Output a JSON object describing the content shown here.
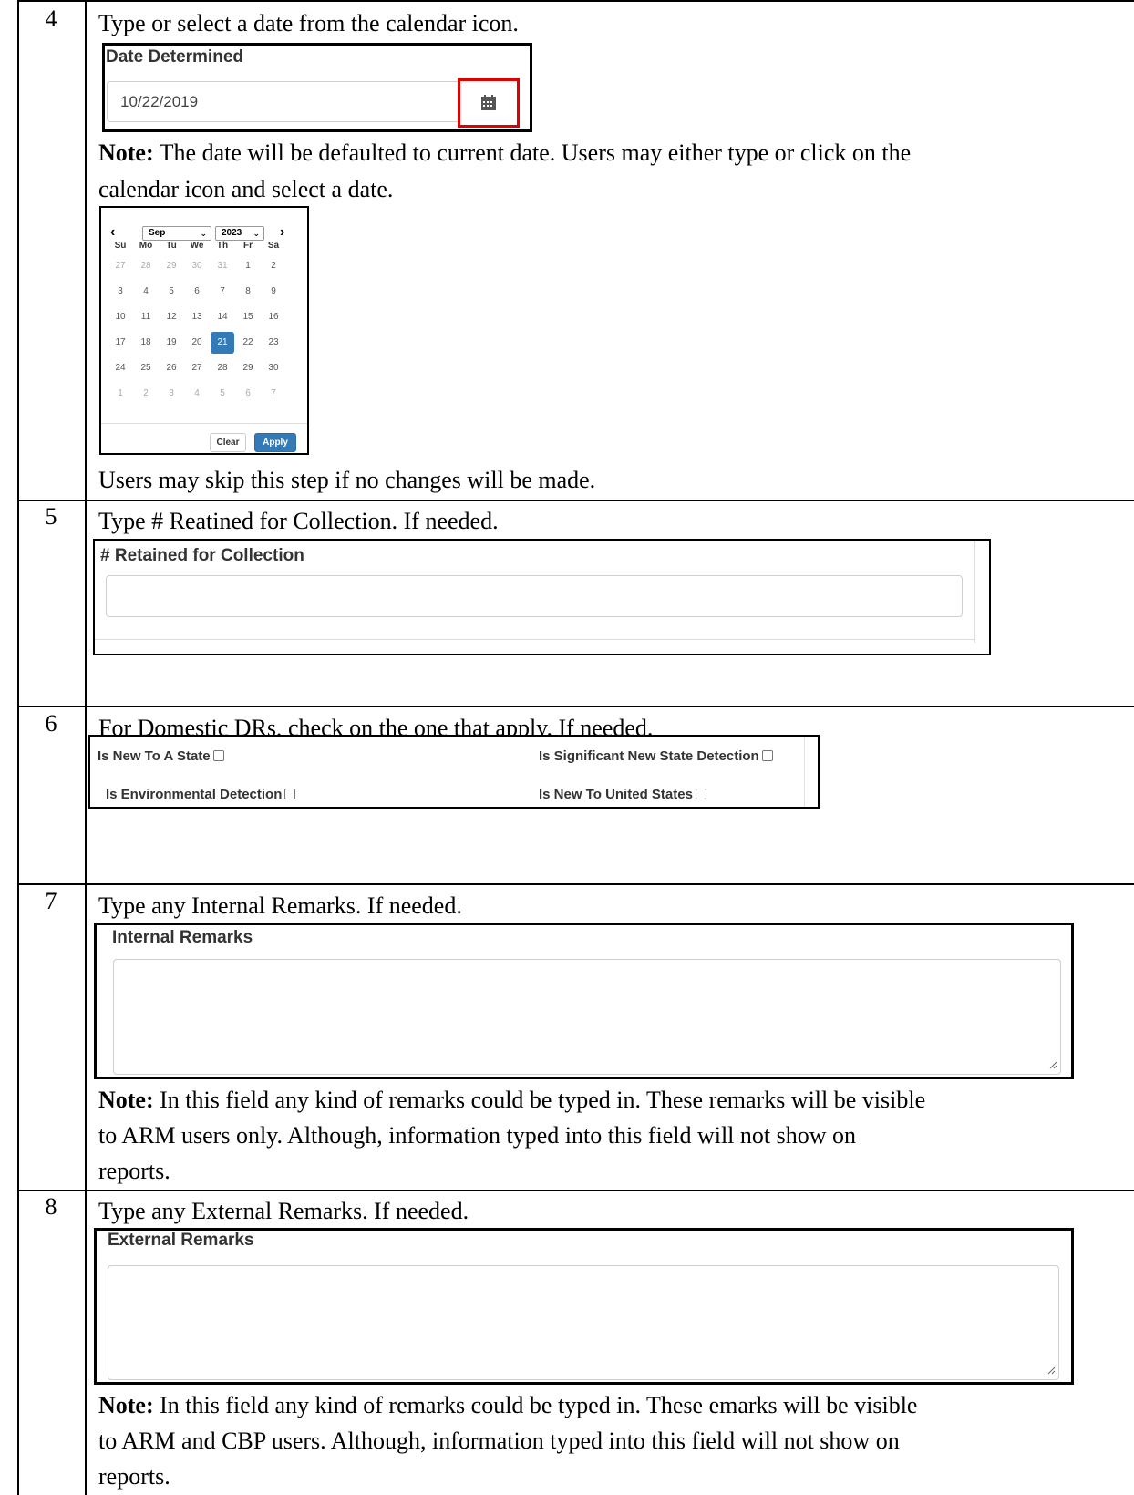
{
  "rows": [
    {
      "number": "4",
      "instruction": "Type or select a date from the calendar icon.",
      "date_field": {
        "label": "Date Determined",
        "value": "10/22/2019",
        "icon": "calendar-icon"
      },
      "note_bold": "Note:",
      "note_line1": " The date will be defaulted to current date. Users may either type or click on the",
      "note_line2": "calendar icon and select a date.",
      "calendar": {
        "prev": "‹",
        "next": "›",
        "month": "Sep",
        "year": "2023",
        "weekdays": [
          "Su",
          "Mo",
          "Tu",
          "We",
          "Th",
          "Fr",
          "Sa"
        ],
        "weeks": [
          [
            "27",
            "28",
            "29",
            "30",
            "31",
            "1",
            "2"
          ],
          [
            "3",
            "4",
            "5",
            "6",
            "7",
            "8",
            "9"
          ],
          [
            "10",
            "11",
            "12",
            "13",
            "14",
            "15",
            "16"
          ],
          [
            "17",
            "18",
            "19",
            "20",
            "21",
            "22",
            "23"
          ],
          [
            "24",
            "25",
            "26",
            "27",
            "28",
            "29",
            "30"
          ],
          [
            "1",
            "2",
            "3",
            "4",
            "5",
            "6",
            "7"
          ]
        ],
        "selected_day": "21",
        "clear_label": "Clear",
        "apply_label": "Apply"
      },
      "skip_text": "Users may skip this step if no changes will be made."
    },
    {
      "number": "5",
      "instruction": "Type # Reatined for Collection. If needed.",
      "field_label": "# Retained for Collection",
      "field_value": ""
    },
    {
      "number": "6",
      "instruction": "For Domestic DRs, check on the one that apply. If needed.",
      "checkboxes": [
        {
          "label": "Is New To A State",
          "checked": false
        },
        {
          "label": "Is Significant New State Detection",
          "checked": false
        },
        {
          "label": "Is Environmental Detection",
          "checked": false
        },
        {
          "label": "Is New To United States",
          "checked": false
        }
      ]
    },
    {
      "number": "7",
      "instruction": "Type any Internal Remarks. If needed.",
      "field_label": "Internal Remarks",
      "field_value": "",
      "note_bold": "Note:",
      "note_line1": " In this field any kind of remarks could be typed in. These remarks will be visible",
      "note_line2": "to ARM users only. Although, information typed into this field will not show on",
      "note_line3": "reports."
    },
    {
      "number": "8",
      "instruction": "Type any External Remarks. If needed.",
      "field_label": "External Remarks",
      "field_value": "",
      "note_bold": "Note:",
      "note_line1": " In this field any kind of remarks could be typed in. These emarks will be visible",
      "note_line2": "to ARM and CBP users. Although, information typed into this field will not show on",
      "note_line3": "reports."
    }
  ],
  "colors": {
    "selected_day": "#337ab7",
    "highlight_border": "#e00000"
  }
}
